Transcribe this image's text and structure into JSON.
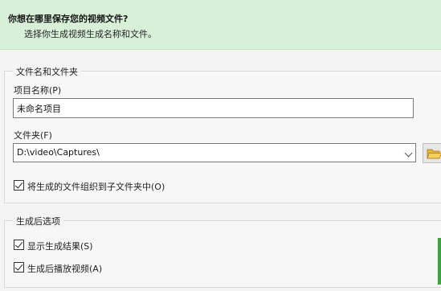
{
  "header": {
    "title": "你想在哪里保存您的视频文件?",
    "subtitle": "选择你生成视频生成名称和文件。"
  },
  "file_group": {
    "legend": "文件名和文件夹",
    "project_name_label": "项目名称(P)",
    "project_name_value": "未命名项目",
    "folder_label": "文件夹(F)",
    "folder_value": "D:\\video\\Captures\\",
    "organize_checkbox": {
      "label": "将生成的文件组织到子文件夹中(O)",
      "checked": true
    }
  },
  "post_group": {
    "legend": "生成后选项",
    "show_results_checkbox": {
      "label": "显示生成结果(S)",
      "checked": true
    },
    "play_after_checkbox": {
      "label": "生成后播放视频(A)",
      "checked": true
    }
  },
  "colors": {
    "header_bg": "#d8efd8",
    "accent_green": "#39a935",
    "folder_icon": "#e8b53a"
  },
  "icons": {
    "folder_browse": "folder-open-icon",
    "dropdown": "chevron-down-icon"
  }
}
